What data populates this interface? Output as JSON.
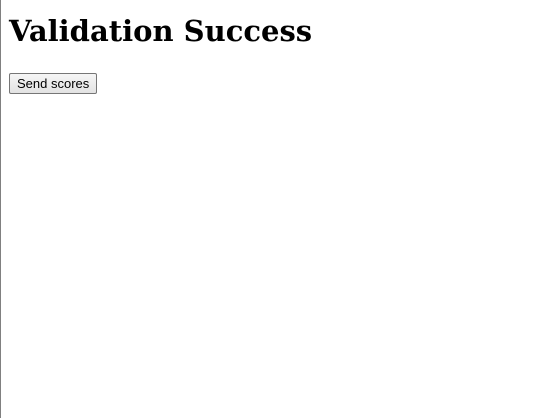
{
  "page": {
    "title": "Validation Success"
  },
  "actions": {
    "send_scores_label": "Send scores"
  }
}
